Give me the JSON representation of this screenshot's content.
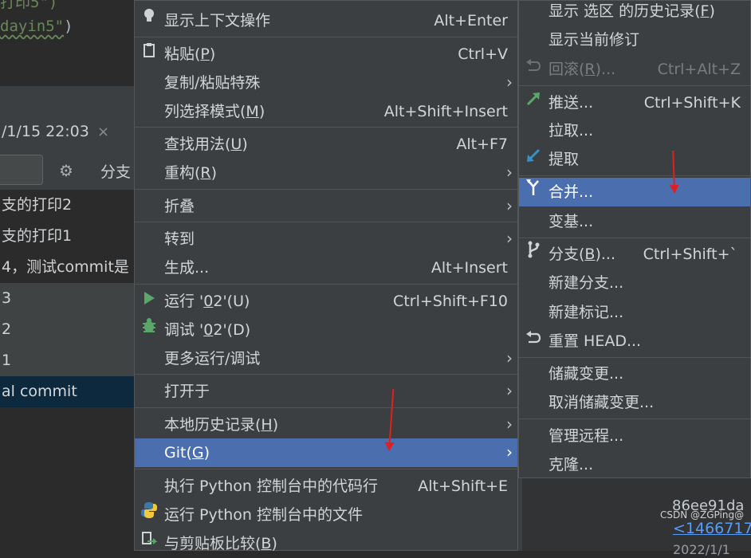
{
  "editor": {
    "line1": "打印5\")",
    "line2_str": "dayin5\"",
    "line2_close": ")"
  },
  "log": {
    "tab_title": "/1/15 22:03",
    "close": "×",
    "branch_label": "分支",
    "commits": [
      "支的打印2",
      "支的打印1",
      "4，测试commit是",
      "3",
      "2",
      "1",
      "al commit"
    ]
  },
  "main_menu": {
    "items": [
      {
        "icon": "bulb-icon",
        "label": "显示上下文操作",
        "shortcut": "Alt+Enter"
      },
      {
        "icon": "clipboard-icon",
        "label": "粘贴(",
        "mn": "P",
        "tail": ")",
        "shortcut": "Ctrl+V"
      },
      {
        "label": "复制/粘贴特殊",
        "submenu": true
      },
      {
        "label": "列选择模式(",
        "mn": "M",
        "tail": ")",
        "shortcut": "Alt+Shift+Insert"
      },
      {
        "label": "查找用法(",
        "mn": "U",
        "tail": ")",
        "shortcut": "Alt+F7"
      },
      {
        "label": "重构(",
        "mn": "R",
        "tail": ")",
        "submenu": true
      },
      {
        "label": "折叠",
        "submenu": true
      },
      {
        "label": "转到",
        "submenu": true
      },
      {
        "label": "生成...",
        "shortcut": "Alt+Insert"
      },
      {
        "icon": "run-icon",
        "label": "运行 '",
        "mn": "0",
        "tail": "2'(U)",
        "shortcut": "Ctrl+Shift+F10"
      },
      {
        "icon": "debug-icon",
        "label": "调试 '",
        "mn": "0",
        "tail": "2'(D)"
      },
      {
        "label": "更多运行/调试",
        "submenu": true
      },
      {
        "label": "打开于",
        "submenu": true
      },
      {
        "label": "本地历史记录(",
        "mn": "H",
        "tail": ")",
        "submenu": true
      },
      {
        "label": "Git(",
        "mn": "G",
        "tail": ")",
        "submenu": true
      },
      {
        "label": "执行 Python 控制台中的代码行",
        "shortcut": "Alt+Shift+E"
      },
      {
        "icon": "python-icon",
        "label": "运行 Python 控制台中的文件"
      },
      {
        "icon": "compare-icon",
        "label": "与剪贴板比较(",
        "mn": "B",
        "tail": ")"
      }
    ]
  },
  "git_menu": {
    "items": [
      {
        "label": "显示 选区 的历史记录(",
        "mn": "F",
        "tail": ")"
      },
      {
        "label": "显示当前修订"
      },
      {
        "icon": "undo-icon",
        "label": "回滚(",
        "mn": "R",
        "tail": ")...",
        "shortcut": "Ctrl+Alt+Z",
        "disabled": true
      },
      {
        "icon": "push-icon",
        "label": "推送...",
        "shortcut": "Ctrl+Shift+K"
      },
      {
        "label": "拉取..."
      },
      {
        "icon": "fetch-icon",
        "label": "提取"
      },
      {
        "icon": "merge-icon",
        "label": "合并..."
      },
      {
        "label": "变基..."
      },
      {
        "icon": "branch-icon",
        "label": "分支(",
        "mn": "B",
        "tail": ")...",
        "shortcut": "Ctrl+Shift+`"
      },
      {
        "label": "新建分支..."
      },
      {
        "label": "新建标记..."
      },
      {
        "icon": "reset-icon",
        "label": "重置 HEAD..."
      },
      {
        "label": "储藏变更..."
      },
      {
        "label": "取消储藏变更..."
      },
      {
        "label": "管理远程..."
      },
      {
        "label": "克隆..."
      }
    ]
  },
  "details": {
    "hash": "86ee91da",
    "link": "<1466717",
    "date": "2022/1/1"
  },
  "watermark": "CSDN @ZGPing@",
  "colors": {
    "menu_bg": "#3c3f41",
    "highlight": "#4b6eaf",
    "selected_row": "#0d293e",
    "annotation": "#e02020"
  }
}
